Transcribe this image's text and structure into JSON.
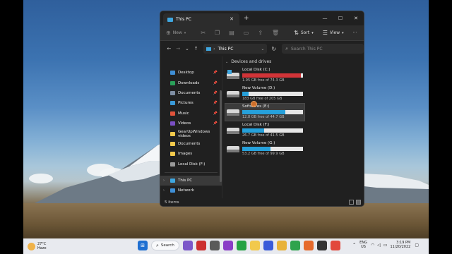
{
  "window": {
    "tab_title": "This PC",
    "new_tab": "+",
    "controls": {
      "minimize": "—",
      "maximize": "☐",
      "close": "✕"
    }
  },
  "commandbar": {
    "new_label": "New",
    "sort_label": "Sort",
    "view_label": "View",
    "more": "···"
  },
  "addressbar": {
    "location": "This PC",
    "search_placeholder": "Search This PC"
  },
  "sidebar": {
    "items": [
      {
        "label": "Desktop",
        "color": "#3f8fd6",
        "pinned": true
      },
      {
        "label": "Downloads",
        "color": "#2aa05a",
        "pinned": true
      },
      {
        "label": "Documents",
        "color": "#7f8ea3",
        "pinned": true
      },
      {
        "label": "Pictures",
        "color": "#3a9ad9",
        "pinned": true
      },
      {
        "label": "Music",
        "color": "#e0533b",
        "pinned": true
      },
      {
        "label": "Videos",
        "color": "#7a4fc4",
        "pinned": true
      },
      {
        "label": "GearUpWindows videos",
        "color": "#f2c94c",
        "pinned": false
      },
      {
        "label": "Documents",
        "color": "#f2c94c",
        "pinned": false
      },
      {
        "label": "Images",
        "color": "#f2c94c",
        "pinned": false
      },
      {
        "label": "Local Disk (F:)",
        "color": "#9a9a9a",
        "pinned": false
      }
    ],
    "this_pc": "This PC",
    "network": "Network"
  },
  "main": {
    "group_header": "Devices and drives",
    "drives": [
      {
        "name": "Local Disk (C:)",
        "free": "1.95 GB free of 74.3 GB",
        "used_fraction": 0.97,
        "full": true,
        "selected": false
      },
      {
        "name": "New Volume (D:)",
        "free": "183 GB free of 205 GB",
        "used_fraction": 0.11,
        "full": false,
        "selected": false
      },
      {
        "name": "Softwares (E:)",
        "free": "12.8 GB free of 44.7 GB",
        "used_fraction": 0.71,
        "full": false,
        "selected": true
      },
      {
        "name": "Local Disk (F:)",
        "free": "26.7 GB free of 41.5 GB",
        "used_fraction": 0.36,
        "full": false,
        "selected": false
      },
      {
        "name": "New Volume (G:)",
        "free": "53.2 GB free of 99.9 GB",
        "used_fraction": 0.47,
        "full": false,
        "selected": false
      }
    ]
  },
  "status": {
    "items": "5 items"
  },
  "taskbar": {
    "weather_temp": "27°C",
    "weather_desc": "Haze",
    "search_label": "Search",
    "lang_top": "ENG",
    "lang_bottom": "US",
    "time": "3:19 PM",
    "date": "11/20/2022"
  },
  "colors": {
    "accent": "#26a0da",
    "full_bar": "#d13438"
  }
}
